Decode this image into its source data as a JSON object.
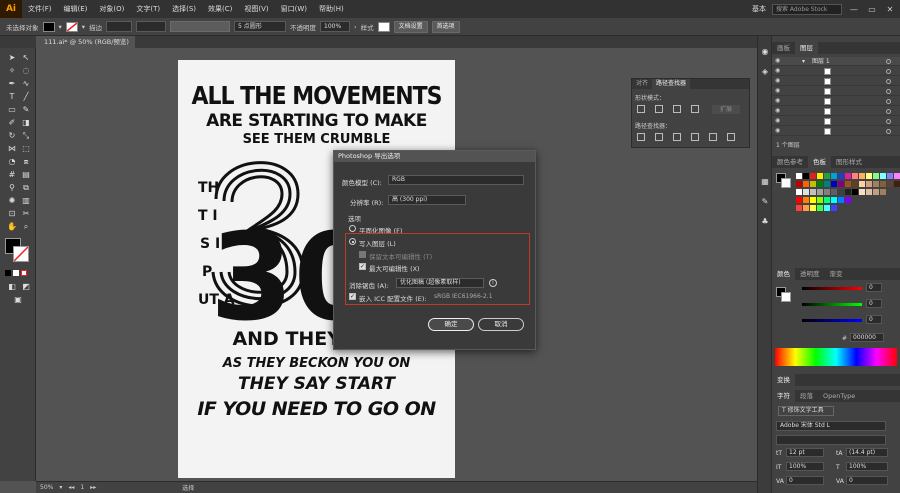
{
  "app": {
    "logo": "Ai"
  },
  "menubar": {
    "items": [
      "文件(F)",
      "编辑(E)",
      "对象(O)",
      "文字(T)",
      "选择(S)",
      "效果(C)",
      "视图(V)",
      "窗口(W)",
      "帮助(H)"
    ],
    "workspace": "基本",
    "search_placeholder": "搜索 Adobe Stock",
    "win_min": "—",
    "win_max": "▭",
    "win_close": "✕"
  },
  "controlbar": {
    "selection_label": "未选择对象",
    "stroke_label": "描边",
    "stroke_value": "",
    "brush_value": "5 点圆形",
    "opacity_label": "不透明度",
    "opacity_value": "100%",
    "style_label": "样式",
    "doc_setup": "文档设置",
    "prefs": "首选项"
  },
  "document": {
    "tab_title": "111.ai* @ 50% (RGB/预览)",
    "tab_close": "×"
  },
  "poster": {
    "lines": [
      "ALL THE MOVEMENTS",
      "ARE STARTING TO MAKE",
      "SEE THEM CRUMBLE",
      "AND THEY CALL",
      "AS THEY BECKON YOU ON",
      "THEY SAY START",
      "IF YOU NEED TO GO ON"
    ],
    "fragments": [
      "TH",
      "T I",
      "S I",
      "P",
      "UT A"
    ],
    "big_number": "30"
  },
  "statusbar": {
    "zoom": "50%",
    "page": "1",
    "tool": "选择"
  },
  "pathfinder": {
    "tab_align": "对齐",
    "tab_pathfinder": "路径查找器",
    "shape_modes": "形状模式：",
    "pathfinders": "路径查找器：",
    "expand": "扩展"
  },
  "layers_panel": {
    "tabs": [
      "画板",
      "图层"
    ],
    "layer_name": "图层 1",
    "footer": "1 个图层"
  },
  "swatches_panel": {
    "tabs": [
      "颜色参考",
      "色板",
      "图形样式"
    ]
  },
  "color_panel": {
    "tabs": [
      "颜色",
      "透明度",
      "渐变"
    ],
    "hex": "000000",
    "r": "0",
    "g": "0",
    "b": "0"
  },
  "transform_panel": {
    "tab": "变换"
  },
  "char_panel": {
    "tabs": [
      "字符",
      "段落",
      "OpenType"
    ],
    "touch_type": "修饰文字工具",
    "font_family": "Adobe 宋体 Std L",
    "font_size": "12 pt",
    "leading": "(14.4 pt)",
    "scale_h": "100%",
    "scale_v": "100%",
    "kerning": "0",
    "tracking": "0"
  },
  "dialog": {
    "title": "Photoshop 导出选项",
    "color_model_label": "颜色模型 (C):",
    "color_model_value": "RGB",
    "resolution_label": "分辨率 (R):",
    "resolution_value": "高 (300 ppi)",
    "options_label": "选项",
    "flat_image": "平面化图像 (F)",
    "write_layers": "写入图层 (L)",
    "preserve_text": "保留文本可编辑性 (T)",
    "max_edit": "最大可编辑性 (X)",
    "antialias_label": "消除锯齿 (A):",
    "antialias_value": "优化图稿 (超像素取样)",
    "embed_icc": "嵌入 ICC 配置文件 (E):",
    "icc_value": "sRGB IEC61966-2.1",
    "ok": "确定",
    "cancel": "取消"
  },
  "colors": {
    "accent_orange": "#ff9a00",
    "panel_bg": "#424242",
    "canvas_bg": "#535353",
    "highlight_red": "#c0392b"
  }
}
